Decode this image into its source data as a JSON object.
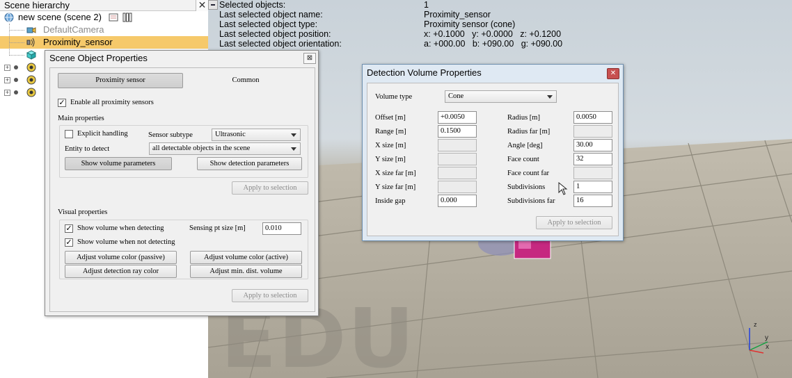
{
  "hierarchy": {
    "title": "Scene hierarchy",
    "close": "✕",
    "root_label": "new scene (scene 2)",
    "items": [
      {
        "label": "DefaultCamera"
      },
      {
        "label": "Proximity_sensor"
      }
    ]
  },
  "info": {
    "rows": [
      {
        "label": "Selected objects:",
        "value": "1"
      },
      {
        "label": "Last selected object name:",
        "value": "Proximity_sensor"
      },
      {
        "label": "Last selected object type:",
        "value": "Proximity sensor (cone)"
      },
      {
        "label": "Last selected object position:",
        "value": "x: +0.1000   y: +0.0000   z: +0.1200"
      },
      {
        "label": "Last selected object orientation:",
        "value": "a: +000.00   b: +090.00   g: +090.00"
      }
    ]
  },
  "watermark": "EDU",
  "axes": {
    "z": "z",
    "y": "y",
    "x": "x"
  },
  "scene_props": {
    "title": "Scene Object Properties",
    "close": "⊠",
    "tabs": {
      "proximity": "Proximity sensor",
      "common": "Common"
    },
    "enable_all": "Enable all proximity sensors",
    "main_title": "Main properties",
    "explicit_handling": "Explicit handling",
    "sensor_subtype_label": "Sensor subtype",
    "sensor_subtype_value": "Ultrasonic",
    "entity_label": "Entity to detect",
    "entity_value": "all detectable objects in the scene",
    "show_volume_params": "Show volume parameters",
    "show_detection_params": "Show detection parameters",
    "apply": "Apply to selection",
    "visual_title": "Visual properties",
    "show_when_detecting": "Show volume when detecting",
    "sensing_pt_label": "Sensing pt size [m]",
    "sensing_pt_value": "0.010",
    "show_when_not_detecting": "Show volume when not detecting",
    "adjust_passive": "Adjust volume color (passive)",
    "adjust_active": "Adjust volume color (active)",
    "adjust_ray": "Adjust detection ray color",
    "adjust_min_dist": "Adjust min. dist. volume",
    "apply2": "Apply to selection"
  },
  "volume_props": {
    "title": "Detection Volume Properties",
    "close": "✕",
    "volume_type_label": "Volume type",
    "volume_type_value": "Cone",
    "left": [
      {
        "label": "Offset [m]",
        "value": "+0.0050",
        "enabled": true
      },
      {
        "label": "Range [m]",
        "value": "0.1500",
        "enabled": true
      },
      {
        "label": "X size [m]",
        "value": "",
        "enabled": false
      },
      {
        "label": "Y size [m]",
        "value": "",
        "enabled": false
      },
      {
        "label": "X size far [m]",
        "value": "",
        "enabled": false
      },
      {
        "label": "Y size far [m]",
        "value": "",
        "enabled": false
      },
      {
        "label": "Inside gap",
        "value": "0.000",
        "enabled": true
      }
    ],
    "right": [
      {
        "label": "Radius [m]",
        "value": "0.0050",
        "enabled": true
      },
      {
        "label": "Radius far [m]",
        "value": "",
        "enabled": false
      },
      {
        "label": "Angle [deg]",
        "value": "30.00",
        "enabled": true
      },
      {
        "label": "Face count",
        "value": "32",
        "enabled": true
      },
      {
        "label": "Face count far",
        "value": "",
        "enabled": false
      },
      {
        "label": "Subdivisions",
        "value": "1",
        "enabled": true
      },
      {
        "label": "Subdivisions far",
        "value": "16",
        "enabled": true
      }
    ],
    "apply": "Apply to selection"
  },
  "colors": {
    "selection": "#f6c96a",
    "title_bar": "#d8e6f2",
    "close_red": "#c75050"
  }
}
